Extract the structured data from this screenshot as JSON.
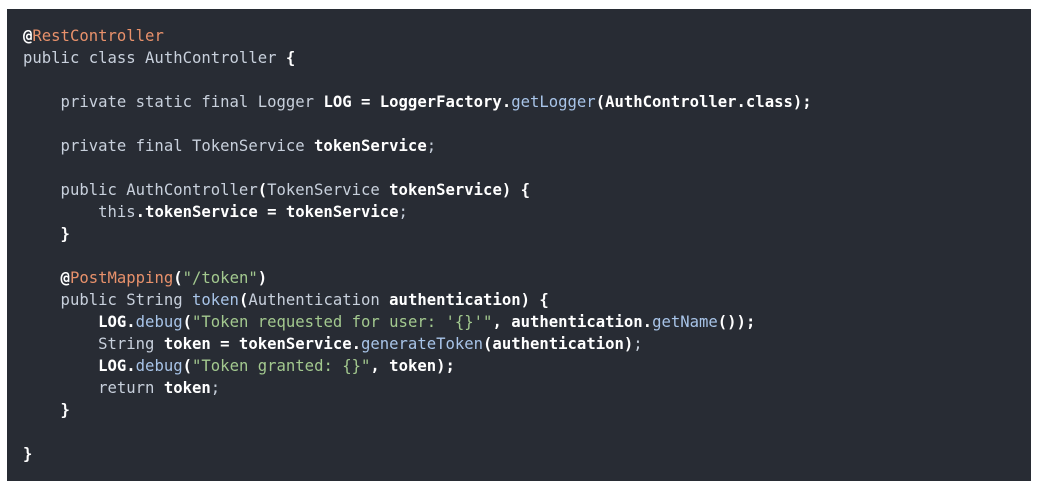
{
  "code": {
    "language": "java",
    "lines": [
      [
        {
          "t": "@",
          "c": "annot-at"
        },
        {
          "t": "RestController",
          "c": "annotation"
        }
      ],
      [
        {
          "t": "public class AuthController ",
          "c": "keyword"
        },
        {
          "t": "{",
          "c": "punct"
        }
      ],
      [],
      [
        {
          "t": "    private static final Logger ",
          "c": "keyword"
        },
        {
          "t": "LOG = LoggerFactory.",
          "c": "ident"
        },
        {
          "t": "getLogger",
          "c": "method"
        },
        {
          "t": "(AuthController.class);",
          "c": "ident"
        }
      ],
      [],
      [
        {
          "t": "    private final TokenService ",
          "c": "keyword"
        },
        {
          "t": "tokenService",
          "c": "ident"
        },
        {
          "t": ";",
          "c": "semi"
        }
      ],
      [],
      [
        {
          "t": "    public AuthController",
          "c": "keyword"
        },
        {
          "t": "(",
          "c": "punct"
        },
        {
          "t": "TokenService ",
          "c": "type"
        },
        {
          "t": "tokenService) {",
          "c": "ident"
        }
      ],
      [
        {
          "t": "        this",
          "c": "keyword"
        },
        {
          "t": ".tokenService = tokenService",
          "c": "ident"
        },
        {
          "t": ";",
          "c": "semi"
        }
      ],
      [
        {
          "t": "    }",
          "c": "punct"
        }
      ],
      [],
      [
        {
          "t": "    @",
          "c": "annot-at"
        },
        {
          "t": "PostMapping",
          "c": "annotation"
        },
        {
          "t": "(",
          "c": "punct"
        },
        {
          "t": "\"/token\"",
          "c": "string"
        },
        {
          "t": ")",
          "c": "punct"
        }
      ],
      [
        {
          "t": "    public String ",
          "c": "keyword"
        },
        {
          "t": "token",
          "c": "method"
        },
        {
          "t": "(",
          "c": "punct"
        },
        {
          "t": "Authentication ",
          "c": "type"
        },
        {
          "t": "authentication) {",
          "c": "ident"
        }
      ],
      [
        {
          "t": "        LOG.",
          "c": "ident"
        },
        {
          "t": "debug",
          "c": "method"
        },
        {
          "t": "(",
          "c": "punct"
        },
        {
          "t": "\"Token requested for user: '{}'\"",
          "c": "string"
        },
        {
          "t": ", authentication.",
          "c": "ident"
        },
        {
          "t": "getName",
          "c": "method"
        },
        {
          "t": "());",
          "c": "punct"
        }
      ],
      [
        {
          "t": "        String ",
          "c": "type"
        },
        {
          "t": "token = tokenService.",
          "c": "ident"
        },
        {
          "t": "generateToken",
          "c": "method"
        },
        {
          "t": "(authentication)",
          "c": "ident"
        },
        {
          "t": ";",
          "c": "semi"
        }
      ],
      [
        {
          "t": "        LOG.",
          "c": "ident"
        },
        {
          "t": "debug",
          "c": "method"
        },
        {
          "t": "(",
          "c": "punct"
        },
        {
          "t": "\"Token granted: {}\"",
          "c": "string"
        },
        {
          "t": ", token);",
          "c": "ident"
        }
      ],
      [
        {
          "t": "        return ",
          "c": "keyword"
        },
        {
          "t": "token",
          "c": "ident"
        },
        {
          "t": ";",
          "c": "semi"
        }
      ],
      [
        {
          "t": "    }",
          "c": "punct"
        }
      ],
      [],
      [
        {
          "t": "}",
          "c": "punct"
        }
      ]
    ]
  },
  "colors": {
    "background": "#282c34",
    "annotation": "#e8916b",
    "string": "#a3c98f",
    "method": "#a8c4e8",
    "keyword": "#c8d0dc",
    "identifier": "#ffffff"
  }
}
